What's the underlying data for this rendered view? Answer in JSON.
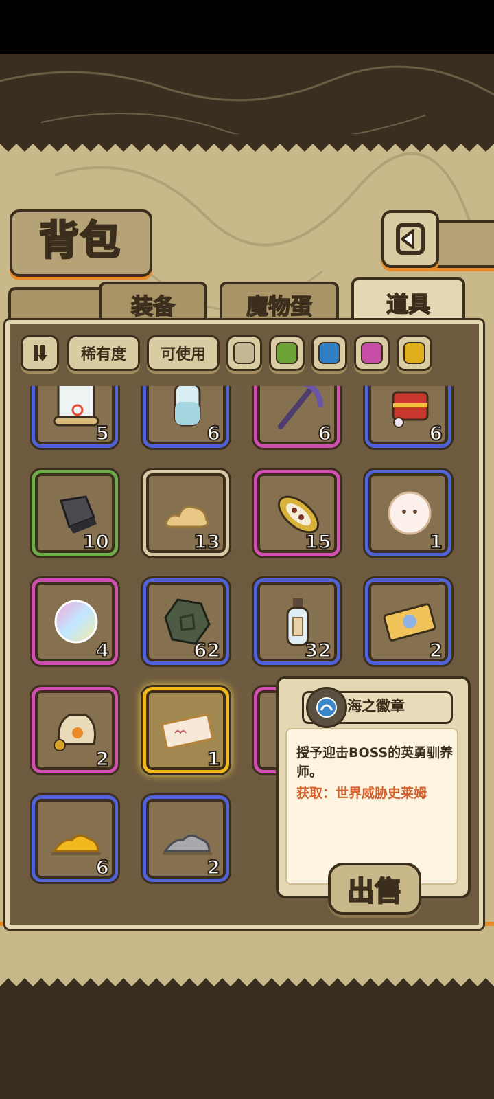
{
  "title": "背包",
  "tabs": [
    {
      "label": "装备",
      "active": false
    },
    {
      "label": "魔物蛋",
      "active": false
    },
    {
      "label": "道具",
      "active": true
    }
  ],
  "filters": {
    "rarity_label": "稀有度",
    "usable_label": "可使用",
    "rarity_colors": [
      "#c7b894",
      "#6ea33a",
      "#2f7fc4",
      "#c74ea7",
      "#dfae1d"
    ]
  },
  "items": [
    {
      "icon": "scroll-icon",
      "qty": "5",
      "rarity": "blue"
    },
    {
      "icon": "water-bottle-icon",
      "qty": "6",
      "rarity": "blue"
    },
    {
      "icon": "pickaxe-icon",
      "qty": "6",
      "rarity": "pink"
    },
    {
      "icon": "treasure-chest-icon",
      "qty": "6",
      "rarity": "blue"
    },
    {
      "icon": "stone-cube-icon",
      "qty": "10",
      "rarity": "green"
    },
    {
      "icon": "dough-icon",
      "qty": "13",
      "rarity": "white"
    },
    {
      "icon": "cocoa-pod-icon",
      "qty": "15",
      "rarity": "pink"
    },
    {
      "icon": "fluffball-icon",
      "qty": "1",
      "rarity": "blue"
    },
    {
      "icon": "rainbow-fluff-icon",
      "qty": "4",
      "rarity": "pink"
    },
    {
      "icon": "rune-stone-icon",
      "qty": "62",
      "rarity": "blue"
    },
    {
      "icon": "message-bottle-icon",
      "qty": "32",
      "rarity": "blue"
    },
    {
      "icon": "ticket-icon",
      "qty": "2",
      "rarity": "blue"
    },
    {
      "icon": "coin-bag-icon",
      "qty": "2",
      "rarity": "pink"
    },
    {
      "icon": "golden-ticket-icon",
      "qty": "1",
      "rarity": "gold"
    },
    {
      "icon": "hidden-item-icon",
      "qty": "",
      "rarity": "pink"
    },
    {
      "icon": "hidden-item-icon",
      "qty": "",
      "rarity": "blue"
    },
    {
      "icon": "gold-ore-icon",
      "qty": "6",
      "rarity": "blue"
    },
    {
      "icon": "silver-ore-icon",
      "qty": "2",
      "rarity": "blue"
    }
  ],
  "tooltip": {
    "name": "海之徽章",
    "description": "授予迎击BOSS的英勇驯养师。",
    "source": "获取：世界威胁史莱姆",
    "badge_icon": "sea-badge-icon"
  },
  "sell_label": "出售"
}
